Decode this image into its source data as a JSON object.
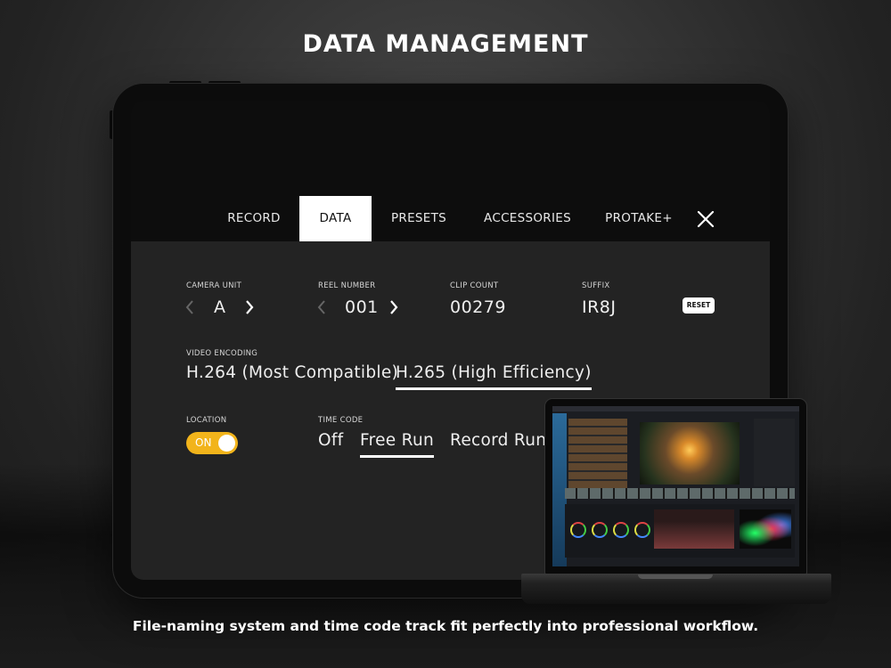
{
  "headline": "DATA MANAGEMENT",
  "caption": "File-naming system and time code track fit perfectly into professional workflow.",
  "tabs": [
    {
      "label": "RECORD",
      "active": false
    },
    {
      "label": "DATA",
      "active": true
    },
    {
      "label": "PRESETS",
      "active": false
    },
    {
      "label": "ACCESSORIES",
      "active": false
    },
    {
      "label": "PROTAKE+",
      "active": false
    }
  ],
  "close_icon": "close-icon",
  "fields": {
    "camera_unit": {
      "label": "CAMERA UNIT",
      "value": "A"
    },
    "reel_number": {
      "label": "REEL NUMBER",
      "value": "001"
    },
    "clip_count": {
      "label": "CLIP COUNT",
      "value": "00279"
    },
    "suffix": {
      "label": "SUFFIX",
      "value": "IR8J"
    },
    "reset_label": "RESET"
  },
  "video_encoding": {
    "label": "VIDEO ENCODING",
    "options": [
      "H.264 (Most Compatible)",
      "H.265 (High Efficiency)"
    ],
    "selected": "H.265 (High Efficiency)"
  },
  "location": {
    "label": "LOCATION",
    "toggle_text": "ON",
    "enabled": true
  },
  "time_code": {
    "label": "TIME CODE",
    "options": [
      "Off",
      "Free Run",
      "Record Run"
    ],
    "selected": "Free Run"
  },
  "colors": {
    "accent_toggle": "#f2b41b",
    "panel_bg": "#232323",
    "active_tab_bg": "#ffffff"
  }
}
